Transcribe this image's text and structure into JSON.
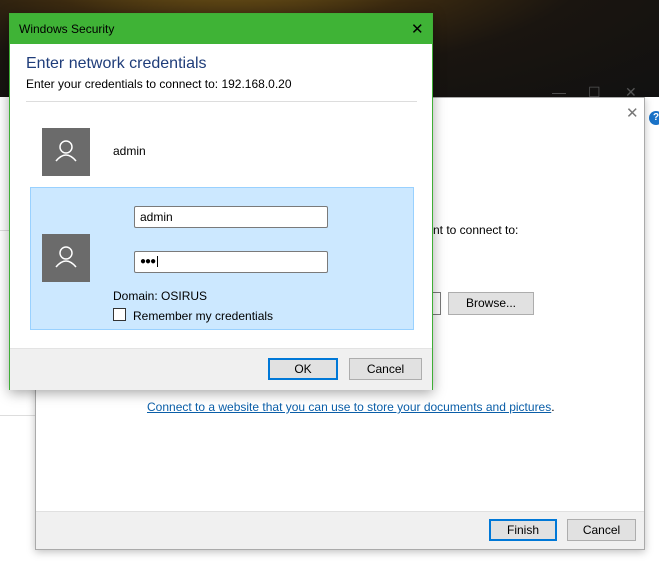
{
  "background_window": {
    "minimize": "—",
    "maximize": "☐",
    "close": "✕",
    "help": "?"
  },
  "wizard": {
    "close": "✕",
    "partial_text": "nt to connect to:",
    "browse_label": "Browse...",
    "link_text": "Connect to a website that you can use to store your documents and pictures",
    "link_suffix": ".",
    "finish_label": "Finish",
    "cancel_label": "Cancel"
  },
  "dialog": {
    "title": "Windows Security",
    "close": "✕",
    "heading": "Enter network credentials",
    "subheading": "Enter your credentials to connect to: 192.168.0.20",
    "saved_user": "admin",
    "username_value": "admin",
    "password_value": "●●●",
    "domain": "Domain: OSIRUS",
    "remember_label": "Remember my credentials",
    "remember_checked": false,
    "ok_label": "OK",
    "cancel_label": "Cancel"
  },
  "colors": {
    "title_bar": "#3fb336",
    "selected_tile": "#cce8ff",
    "heading": "#1f3d7a",
    "link": "#0a5ea8"
  }
}
